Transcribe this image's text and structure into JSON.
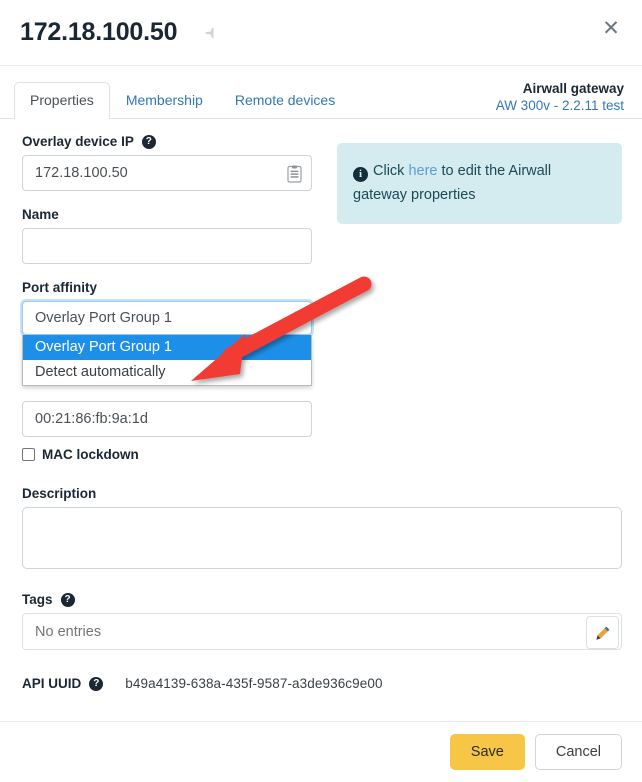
{
  "header": {
    "title": "172.18.100.50",
    "pin_icon": "pushpin-icon",
    "close_label": "✕"
  },
  "tabs": [
    {
      "label": "Properties",
      "active": true
    },
    {
      "label": "Membership",
      "active": false
    },
    {
      "label": "Remote devices",
      "active": false
    }
  ],
  "gateway": {
    "title": "Airwall gateway",
    "subtitle": "AW 300v - 2.2.11 test"
  },
  "form": {
    "overlay_device_ip": {
      "label": "Overlay device IP",
      "value": "172.18.100.50",
      "help": "?",
      "copy_icon": "clipboard-copy-icon"
    },
    "name": {
      "label": "Name",
      "value": "",
      "placeholder": ""
    },
    "port_affinity": {
      "label": "Port affinity",
      "selected": "Overlay Port Group 1",
      "expanded": true,
      "options": [
        {
          "label": "Overlay Port Group 1",
          "selected": true
        },
        {
          "label": "Detect automatically",
          "selected": false
        }
      ]
    },
    "mac_address": {
      "value": "00:21:86:fb:9a:1d",
      "placeholder": ""
    },
    "mac_lockdown": {
      "label": "MAC lockdown",
      "checked": false
    },
    "description": {
      "label": "Description",
      "value": "",
      "placeholder": ""
    },
    "tags": {
      "label": "Tags",
      "help": "?",
      "value": "",
      "placeholder": "No entries",
      "edit_icon": "pencil-edit-icon"
    },
    "api_uuid": {
      "label": "API UUID",
      "help": "?",
      "value": "b49a4139-638a-435f-9587-a3de936c9e00"
    }
  },
  "info_box": {
    "prefix": "Click ",
    "link": "here",
    "suffix": " to edit the Airwall gateway properties",
    "icon": "info-icon"
  },
  "footer": {
    "save_label": "Save",
    "cancel_label": "Cancel"
  },
  "annotation": {
    "arrow_color": "#f23b33",
    "arrow_target": "Overlay Port Group 1"
  },
  "colors": {
    "accent_link": "#3277b8",
    "save_yellow": "#f7c646",
    "info_bg": "#d4ebf0",
    "selected_blue": "#1e8fe8",
    "arrow_red": "#f23b33"
  }
}
